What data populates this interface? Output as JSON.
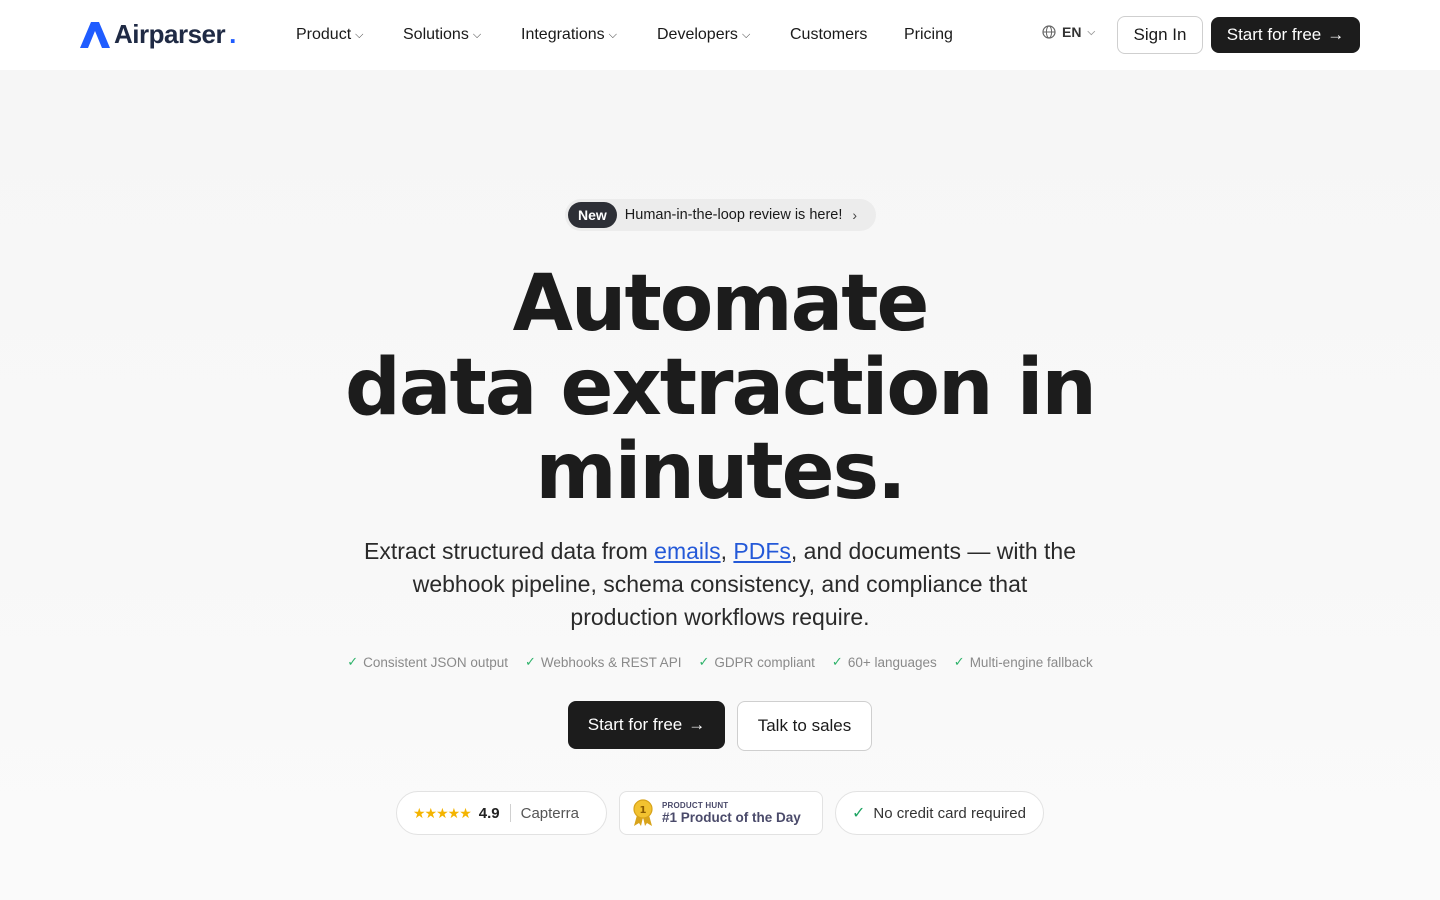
{
  "brand": {
    "name": "Airparser",
    "dot": "."
  },
  "nav": {
    "items": [
      {
        "label": "Product",
        "has_dropdown": true
      },
      {
        "label": "Solutions",
        "has_dropdown": true
      },
      {
        "label": "Integrations",
        "has_dropdown": true
      },
      {
        "label": "Developers",
        "has_dropdown": true
      },
      {
        "label": "Customers",
        "has_dropdown": false
      },
      {
        "label": "Pricing",
        "has_dropdown": false
      }
    ],
    "language": "EN",
    "sign_in": "Sign In",
    "start_free": "Start for free",
    "arrow": "→"
  },
  "hero": {
    "pill_tag": "New",
    "pill_text": "Human-in-the-loop review is here!",
    "pill_arrow": "›",
    "headline_line1": "Automate",
    "headline_line2": "data extraction in",
    "headline_line3": "minutes.",
    "sub_prefix": "Extract structured data from ",
    "sub_link1": "emails",
    "sub_comma": ", ",
    "sub_link2": "PDFs",
    "sub_suffix": ", and documents — with the webhook pipeline, schema consistency, and compliance that production workflows require.",
    "features": [
      "Consistent JSON output",
      "Webhooks & REST API",
      "GDPR compliant",
      "60+ languages",
      "Multi-engine fallback"
    ],
    "cta_primary": "Start for free",
    "cta_arrow": "→",
    "cta_secondary": "Talk to sales"
  },
  "badges": {
    "capterra": {
      "stars": "★★★★★",
      "rating": "4.9",
      "source": "Capterra"
    },
    "producthunt": {
      "small": "PRODUCT HUNT",
      "big": "#1 Product of the Day",
      "medal": "1"
    },
    "no_cc": {
      "text": "No credit card required"
    }
  },
  "colors": {
    "accent_blue": "#1f5cff",
    "link_blue": "#2459d8",
    "dark_button": "#1c1c1c",
    "check_green": "#2fb36b",
    "star_yellow": "#f4b400"
  },
  "icons": {
    "language": "globe-icon",
    "dropdown": "chevron-down-icon",
    "feature_check": "check-icon",
    "medal": "medal-icon"
  }
}
